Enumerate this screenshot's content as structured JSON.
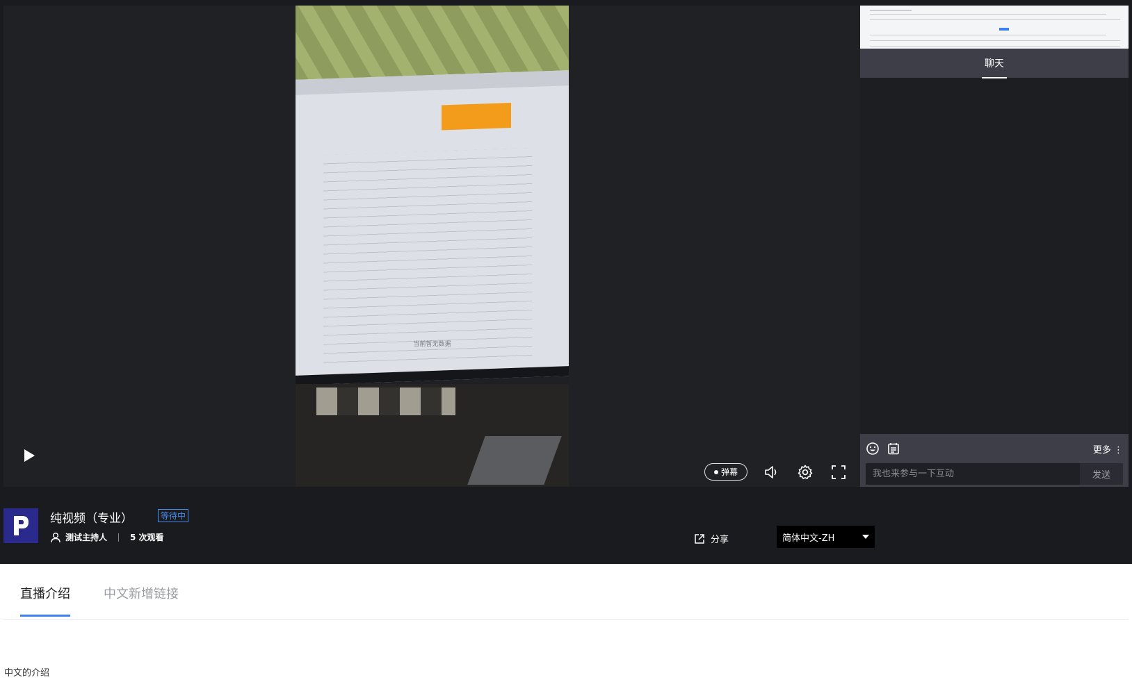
{
  "player": {
    "video_screen_note": "当前暂无数据",
    "danmu_label": "弹幕"
  },
  "chat": {
    "tab_label": "聊天",
    "more_label": "更多",
    "input_placeholder": "我也来参与一下互动",
    "send_label": "发送"
  },
  "info": {
    "title": "纯视频（专业）",
    "status_badge": "等待中",
    "host": "测试主持人",
    "views": "5 次观看",
    "share_label": "分享",
    "language": "简体中文-ZH"
  },
  "tabs": [
    "直播介绍",
    "中文新增链接"
  ],
  "description": "中文的介绍",
  "colors": {
    "accent": "#3d7ef0",
    "badge": "#4a8cf0",
    "dark_bg": "#1a1b1e",
    "logo_bg": "#2a2a8c"
  }
}
